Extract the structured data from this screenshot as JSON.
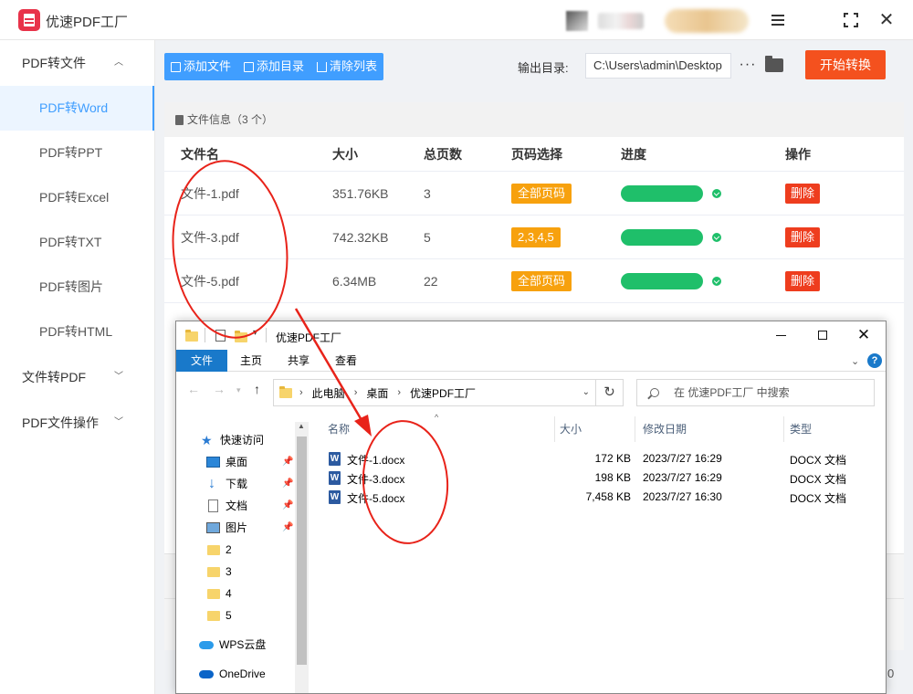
{
  "app": {
    "title": "优速PDF工厂"
  },
  "sidebar": {
    "groups": [
      {
        "label": "PDF转文件",
        "chevron": "⌃"
      },
      {
        "label": "文件转PDF",
        "chevron": "⌄"
      },
      {
        "label": "PDF文件操作",
        "chevron": "⌄"
      }
    ],
    "items": [
      {
        "label": "PDF转Word"
      },
      {
        "label": "PDF转PPT"
      },
      {
        "label": "PDF转Excel"
      },
      {
        "label": "PDF转TXT"
      },
      {
        "label": "PDF转图片"
      },
      {
        "label": "PDF转HTML"
      }
    ]
  },
  "toolbar": {
    "add_file": "添加文件",
    "add_dir": "添加目录",
    "clear_list": "清除列表",
    "output_label": "输出目录:",
    "output_path": "C:\\Users\\admin\\Desktop",
    "more": "···",
    "start": "开始转换"
  },
  "file_panel": {
    "header": "文件信息（3 个）",
    "columns": [
      "文件名",
      "大小",
      "总页数",
      "页码选择",
      "进度",
      "操作"
    ],
    "rows": [
      {
        "name": "文件-1.pdf",
        "size": "351.76KB",
        "pages": "3",
        "page_select": "全部页码",
        "progress": 1.0,
        "action": "删除"
      },
      {
        "name": "文件-3.pdf",
        "size": "742.32KB",
        "pages": "5",
        "page_select": "2,3,4,5",
        "progress": 1.0,
        "action": "删除"
      },
      {
        "name": "文件-5.pdf",
        "size": "6.34MB",
        "pages": "22",
        "page_select": "全部页码",
        "progress": 1.0,
        "action": "删除"
      }
    ],
    "footer_count": "0"
  },
  "explorer": {
    "title": "优速PDF工厂",
    "ribbon_tabs": [
      "文件",
      "主页",
      "共享",
      "查看"
    ],
    "address": [
      "此电脑",
      "桌面",
      "优速PDF工厂"
    ],
    "search_placeholder": "在 优速PDF工厂 中搜索",
    "tree": [
      {
        "label": "快速访问",
        "icon": "star-icon",
        "pinned": false
      },
      {
        "label": "桌面",
        "icon": "desktop-icon",
        "pinned": true
      },
      {
        "label": "下载",
        "icon": "download-icon",
        "pinned": true
      },
      {
        "label": "文档",
        "icon": "document-icon",
        "pinned": true
      },
      {
        "label": "图片",
        "icon": "picture-icon",
        "pinned": true
      },
      {
        "label": "2",
        "icon": "folder-icon",
        "pinned": false
      },
      {
        "label": "3",
        "icon": "folder-icon",
        "pinned": false
      },
      {
        "label": "4",
        "icon": "folder-icon",
        "pinned": false
      },
      {
        "label": "5",
        "icon": "folder-icon",
        "pinned": false
      },
      {
        "label": "WPS云盘",
        "icon": "cloud-icon",
        "pinned": false
      },
      {
        "label": "OneDrive",
        "icon": "onedrive-icon",
        "pinned": false
      }
    ],
    "columns": [
      "名称",
      "大小",
      "修改日期",
      "类型"
    ],
    "files": [
      {
        "name": "文件-1.docx",
        "size": "172 KB",
        "date": "2023/7/27 16:29",
        "type": "DOCX 文档"
      },
      {
        "name": "文件-3.docx",
        "size": "198 KB",
        "date": "2023/7/27 16:29",
        "type": "DOCX 文档"
      },
      {
        "name": "文件-5.docx",
        "size": "7,458 KB",
        "date": "2023/7/27 16:30",
        "type": "DOCX 文档"
      }
    ]
  },
  "colors": {
    "accent": "#409eff",
    "start_button": "#f4511e",
    "page_tag": "#f7a10e",
    "progress": "#1fbf6a",
    "delete_button": "#ee3d1e",
    "annotation": "#e8231a"
  }
}
